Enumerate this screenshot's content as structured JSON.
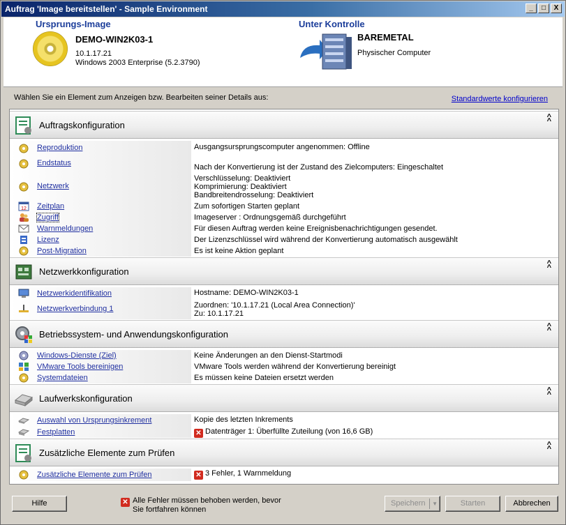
{
  "window": {
    "title": "Auftrag 'Image bereitstellen' - Sample Environment",
    "buttons": {
      "minimize": "_",
      "maximize": "□",
      "close": "X"
    }
  },
  "source": {
    "label": "Ursprungs-Image",
    "name": "DEMO-WIN2K03-1",
    "ip": "10.1.17.21",
    "os": "Windows 2003 Enterprise (5.2.3790)"
  },
  "target": {
    "label": "Unter Kontrolle",
    "name": "BAREMETAL",
    "type": "Physischer Computer"
  },
  "prompt": "Wählen Sie ein Element zum Anzeigen bzw. Bearbeiten seiner Details aus:",
  "config_defaults_link": "Standardwerte konfigurieren",
  "sections": {
    "auftrag": {
      "title": "Auftragskonfiguration",
      "rows": [
        {
          "label": "Reproduktion",
          "value": "Ausgangsursprungscomputer  angenommen:  Offline",
          "icon": "gear-icon"
        },
        {
          "label": "Endstatus",
          "value": "Nach der Konvertierung ist der Zustand des Zielcomputers: Eingeschaltet",
          "icon": "gear-icon"
        },
        {
          "label": "Netzwerk",
          "value1": "Verschlüsselung: Deaktiviert",
          "value2": "Komprimierung: Deaktiviert",
          "value3": "Bandbreitendrosselung: Deaktiviert",
          "icon": "gear-icon"
        },
        {
          "label": "Zeitplan",
          "value": "Zum sofortigen Starten geplant",
          "icon": "calendar-icon"
        },
        {
          "label": "Zugriff",
          "value": "Imageserver : Ordnungsgemäß durchgeführt",
          "icon": "users-icon"
        },
        {
          "label": "Warnmeldungen",
          "value": "Für diesen Auftrag werden keine Ereignisbenachrichtigungen gesendet.",
          "icon": "envelope-icon"
        },
        {
          "label": "Lizenz",
          "value": "Der Lizenzschlüssel wird während der Konvertierung automatisch ausgewählt",
          "icon": "license-icon"
        },
        {
          "label": "Post-Migration",
          "value": "Es ist keine Aktion geplant",
          "icon": "gear-icon"
        }
      ]
    },
    "netzwerk": {
      "title": "Netzwerkkonfiguration",
      "rows": [
        {
          "label": "Netzwerkidentifikation",
          "value": "Hostname: DEMO-WIN2K03-1",
          "icon": "network-id-icon"
        },
        {
          "label": "Netzwerkverbindung 1",
          "value1": "Zuordnen: '10.1.17.21 (Local Area Connection)'",
          "value2": "Zu: 10.1.17.21",
          "icon": "network-connection-icon"
        }
      ]
    },
    "betrieb": {
      "title": "Betriebssystem- und Anwendungskonfiguration",
      "rows": [
        {
          "label": "Windows-Dienste (Ziel)",
          "value": "Keine Änderungen an den Dienst-Startmodi",
          "icon": "gear-icon"
        },
        {
          "label": "VMware Tools bereinigen",
          "value": "VMware Tools werden während der Konvertierung bereinigt",
          "icon": "vmware-icon"
        },
        {
          "label": "Systemdateien",
          "value": "Es müssen keine Dateien ersetzt werden",
          "icon": "gear-icon"
        }
      ]
    },
    "laufwerk": {
      "title": "Laufwerkskonfiguration",
      "rows": [
        {
          "label": "Auswahl von Ursprungsinkrement",
          "value": "Kopie des letzten Inkrements",
          "icon": "disk-icon"
        },
        {
          "label": "Festplatten",
          "value": "Datenträger 1:  Überfüllte Zuteilung (von 16,6 GB)",
          "icon": "harddisk-icon",
          "status": "error"
        }
      ]
    },
    "zusatz": {
      "title": "Zusätzliche Elemente zum Prüfen",
      "rows": [
        {
          "label": "Zusätzliche Elemente zum Prüfen",
          "value": "3 Fehler, 1 Warnmeldung",
          "icon": "gear-icon",
          "status": "error"
        }
      ]
    }
  },
  "footer": {
    "help": "Hilfe",
    "message_line1": "Alle Fehler müssen behoben werden, bevor",
    "message_line2": "Sie fortfahren können",
    "save": "Speichern",
    "start": "Starten",
    "cancel": "Abbrechen"
  },
  "colors": {
    "link": "#1f2fa0",
    "header_label": "#1b3d9a",
    "error": "#d12b1f"
  }
}
